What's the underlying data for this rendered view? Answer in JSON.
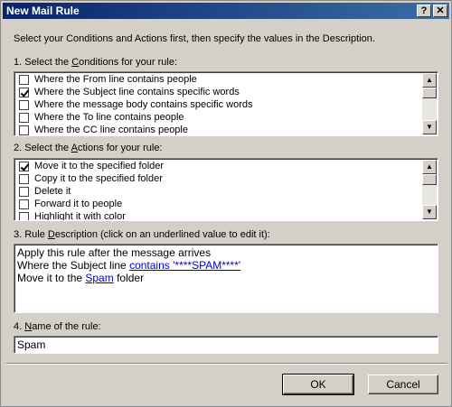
{
  "window": {
    "title": "New Mail Rule",
    "help_glyph": "?",
    "close_glyph": "✕"
  },
  "intro": "Select your Conditions and Actions first, then specify the values in the Description.",
  "conditions": {
    "label_pre": "1. Select the ",
    "label_u": "C",
    "label_post": "onditions for your rule:",
    "items": [
      {
        "label": "Where the From line contains people",
        "checked": false
      },
      {
        "label": "Where the Subject line contains specific words",
        "checked": true
      },
      {
        "label": "Where the message body contains specific words",
        "checked": false
      },
      {
        "label": "Where the To line contains people",
        "checked": false
      },
      {
        "label": "Where the CC line contains people",
        "checked": false
      }
    ]
  },
  "actions": {
    "label_pre": "2. Select the ",
    "label_u": "A",
    "label_post": "ctions for your rule:",
    "items": [
      {
        "label": "Move it to the specified folder",
        "checked": true
      },
      {
        "label": "Copy it to the specified folder",
        "checked": false
      },
      {
        "label": "Delete it",
        "checked": false
      },
      {
        "label": "Forward it to people",
        "checked": false
      },
      {
        "label": "Highlight it with color",
        "checked": false
      }
    ]
  },
  "description": {
    "label_pre": "3. Rule ",
    "label_u": "D",
    "label_post": "escription (click on an underlined value to edit it):",
    "line1": "Apply this rule after the message arrives",
    "line2_pre": "Where the Subject line ",
    "line2_link": "contains '****SPAM****'",
    "line3_pre": "Move it to the ",
    "line3_link": "Spam",
    "line3_post": " folder"
  },
  "rule_name": {
    "label_pre": "4. ",
    "label_u": "N",
    "label_post": "ame of the rule:",
    "value": "Spam"
  },
  "buttons": {
    "ok": "OK",
    "cancel": "Cancel"
  }
}
